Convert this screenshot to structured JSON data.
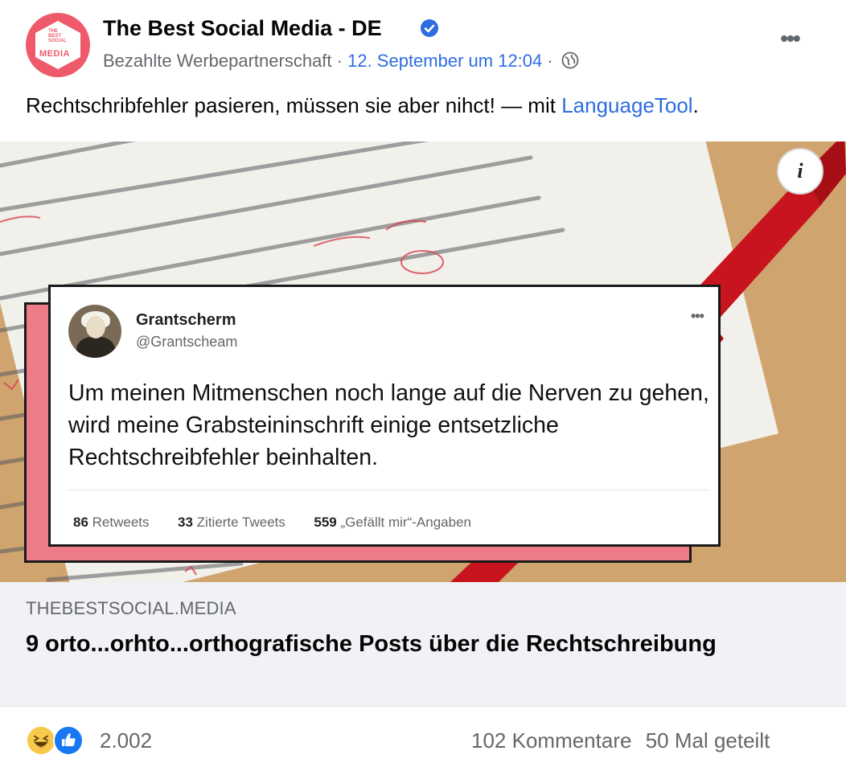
{
  "post": {
    "page_name": "The Best Social Media - DE",
    "subtitle": "Bezahlte Werbepartnerschaft",
    "separator": "·",
    "date": "12. September um 12:04",
    "text": "Rechtschribfehler pasieren, müssen sie aber nihct! — mit ",
    "text_link": "LanguageTool",
    "text_end": ".",
    "avatar_label": "MEDIA",
    "avatar_mini": "THE BEST SOCIAL"
  },
  "image": {
    "tweet": {
      "name": "Grantscherm",
      "handle": "@Grantscheam",
      "body": "Um meinen Mitmenschen noch lange auf die Nerven zu gehen, wird meine Grabsteininschrift einige entsetzliche Rechtschreibfehler beinhalten.",
      "retweets_count": "86",
      "retweets_label": "Retweets",
      "quotes_count": "33",
      "quotes_label": "Zitierte Tweets",
      "likes_count": "559",
      "likes_label": "„Gefällt mir“-Angaben"
    },
    "info_label": "i"
  },
  "link_preview": {
    "domain": "THEBESTSOCIAL.MEDIA",
    "title": "9 orto...orhto...orthografische Posts über die Rechtschreibung"
  },
  "footer": {
    "reaction_count": "2.002",
    "comments": "102 Kommentare",
    "shares": "50 Mal geteilt"
  },
  "icons": {
    "verified": "verified-badge-icon",
    "globe": "globe-icon",
    "more": "more-options-icon",
    "info": "info-icon",
    "haha": "haha-reaction-icon",
    "like": "like-reaction-icon"
  },
  "colors": {
    "link_blue": "#2d6de0",
    "muted": "#65676b",
    "brand_pink": "#ee5a6b",
    "card_pink": "#ee7c88"
  }
}
